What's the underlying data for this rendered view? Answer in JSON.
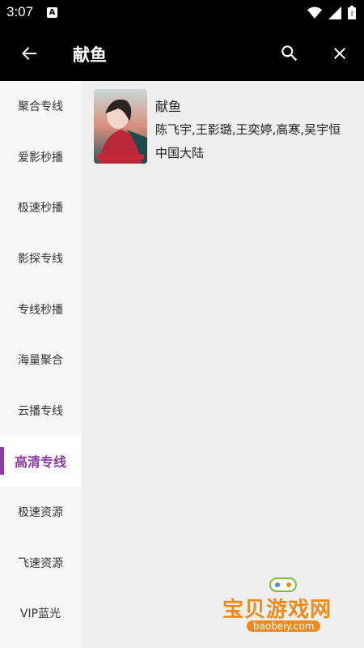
{
  "status": {
    "time": "3:07",
    "notification_letter": "A"
  },
  "appbar": {
    "title": "献鱼"
  },
  "sidebar": {
    "items": [
      {
        "label": "聚合专线"
      },
      {
        "label": "爱影秒播"
      },
      {
        "label": "极速秒播"
      },
      {
        "label": "影探专线"
      },
      {
        "label": "专线秒播"
      },
      {
        "label": "海量聚合"
      },
      {
        "label": "云播专线"
      },
      {
        "label": "高清专线"
      },
      {
        "label": "极速资源"
      },
      {
        "label": "飞速资源"
      },
      {
        "label": "VIP蓝光"
      }
    ],
    "active_index": 7
  },
  "results": [
    {
      "name": "献鱼",
      "actors": "陈飞宇,王影璐,王奕婷,高寒,吴宇恒",
      "region": "中国大陆"
    }
  ],
  "watermark": {
    "text": "宝贝游戏网",
    "url": "baobeiy.com"
  },
  "colors": {
    "accent": "#8a3fa0",
    "bar": "#000000"
  }
}
